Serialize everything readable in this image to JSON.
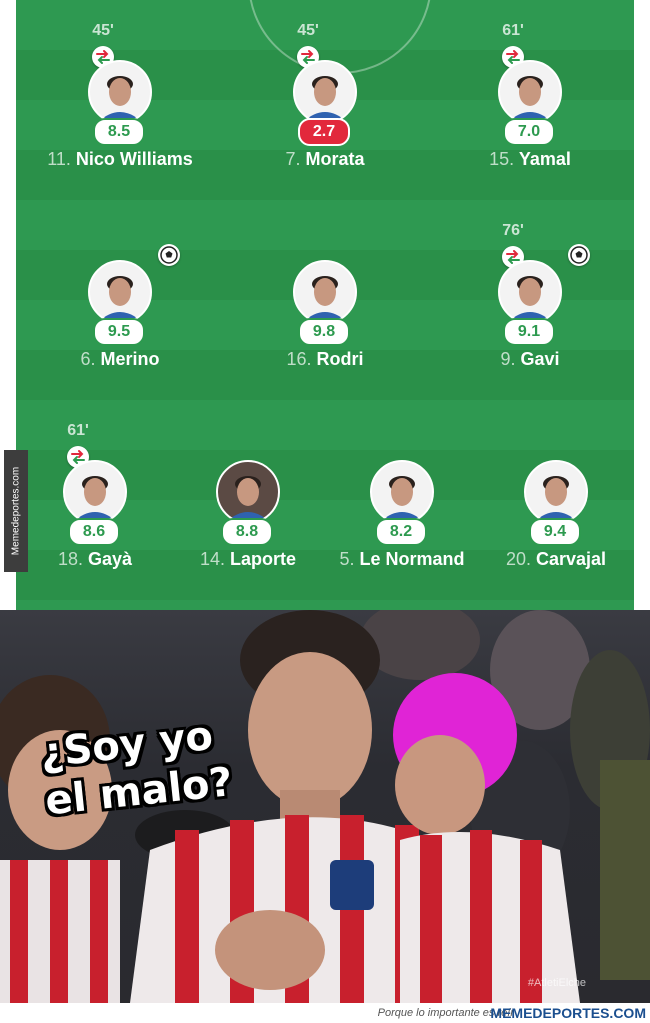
{
  "lineup": {
    "players": [
      {
        "number": "11.",
        "name": "Nico Williams",
        "rating": "8.5",
        "minute": "45'",
        "subbed": true,
        "goal": false,
        "low": false
      },
      {
        "number": "7.",
        "name": "Morata",
        "rating": "2.7",
        "minute": "45'",
        "subbed": true,
        "goal": false,
        "low": true
      },
      {
        "number": "15.",
        "name": "Yamal",
        "rating": "7.0",
        "minute": "61'",
        "subbed": true,
        "goal": false,
        "low": false
      },
      {
        "number": "6.",
        "name": "Merino",
        "rating": "9.5",
        "minute": "",
        "subbed": false,
        "goal": true,
        "low": false
      },
      {
        "number": "16.",
        "name": "Rodri",
        "rating": "9.8",
        "minute": "",
        "subbed": false,
        "goal": false,
        "low": false
      },
      {
        "number": "9.",
        "name": "Gavi",
        "rating": "9.1",
        "minute": "76'",
        "subbed": true,
        "goal": true,
        "low": false
      },
      {
        "number": "18.",
        "name": "Gayà",
        "rating": "8.6",
        "minute": "61'",
        "subbed": true,
        "goal": false,
        "low": false
      },
      {
        "number": "14.",
        "name": "Laporte",
        "rating": "8.8",
        "minute": "",
        "subbed": false,
        "goal": false,
        "low": false
      },
      {
        "number": "5.",
        "name": "Le Normand",
        "rating": "8.2",
        "minute": "",
        "subbed": false,
        "goal": false,
        "low": false
      },
      {
        "number": "20.",
        "name": "Carvajal",
        "rating": "9.4",
        "minute": "",
        "subbed": false,
        "goal": false,
        "low": false
      }
    ],
    "watermark": "Memedeportes.com"
  },
  "photo": {
    "caption_line1": "¿Soy yo",
    "caption_line2": "el malo?",
    "hashtag": "#AtletiElche"
  },
  "footer": {
    "tagline": "Porque lo importante es reír",
    "site": "MEMEDEPORTES.COM"
  },
  "colors": {
    "pitch": "#2e9951",
    "rating_green": "#2d9a4f",
    "rating_red": "#e2283c",
    "sub_out": "#e2283c",
    "sub_in": "#2d9a4f"
  },
  "icons": {
    "sub": "substitution-icon",
    "goal": "soccer-ball-icon",
    "avatar": "player-avatar"
  }
}
